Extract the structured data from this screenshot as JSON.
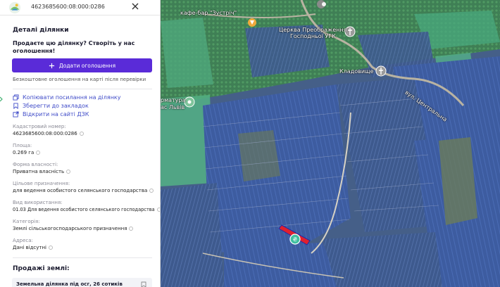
{
  "header": {
    "cadastral": "4623685600:08:000:0286",
    "logo_icon": "land-logo-icon",
    "close_icon": "close-icon"
  },
  "panel": {
    "title": "Деталі ділянки",
    "promo_line1": "Продаєте цю ділянку? Створіть у нас",
    "promo_line2": "оголошення!",
    "add_button": "Додати оголошення",
    "free_note": "Безкоштовне оголошення на карті після перевірки",
    "links": [
      {
        "label": "Копіювати посилання на ділянку",
        "icon": "copy-icon"
      },
      {
        "label": "Зберегти до закладок",
        "icon": "bookmark-icon"
      },
      {
        "label": "Відкрити на сайті ДЗК",
        "icon": "external-link-icon"
      }
    ],
    "fields": [
      {
        "label": "Кадастровий номер:",
        "value": "4623685600:08:000:0286"
      },
      {
        "label": "Площа:",
        "value": "0.269 га"
      },
      {
        "label": "Форма власності:",
        "value": "Приватна власність"
      },
      {
        "label": "Цільове призначення:",
        "value": "для ведення особистого селянського господарства"
      },
      {
        "label": "Вид використання:",
        "value": "01.03 Для ведення особистого селянського господарства"
      },
      {
        "label": "Категорія:",
        "value": "Землі сільськогосподарського призначення"
      },
      {
        "label": "Адреса:",
        "value": "Дані відсутні"
      }
    ],
    "sales_title": "Продажі землі:",
    "sale_card": "Земельна ділянка під осг, 26 сотиків"
  },
  "map": {
    "labels": {
      "cafe": "кафе-бар \"Зустріч\"",
      "church": "Церква Преображення",
      "church2": "Господньої УГК",
      "cemetery": "Кладовище",
      "street": "вул. Центральна",
      "pharm": "рматура",
      "lviv": "ас Львів"
    },
    "colors": {
      "accent": "#5a2bd8",
      "parcel": "#e0202e",
      "parcel_outline": "#1f2aa8",
      "marker": "#3fc0a0"
    }
  }
}
